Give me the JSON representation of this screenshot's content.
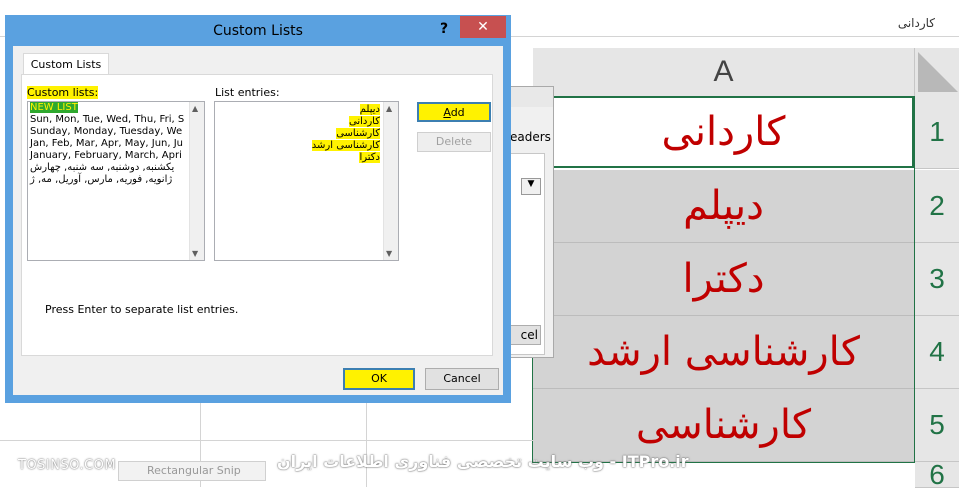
{
  "excel": {
    "formula_text": "کاردانی",
    "column_header": "A",
    "cells": [
      "کاردانی",
      "دیپلم",
      "دکترا",
      "کارشناسی ارشد",
      "کارشناسی"
    ],
    "row_numbers": [
      "1",
      "2",
      "3",
      "4",
      "5",
      "6"
    ]
  },
  "behind_dialog": {
    "partial_text": "eaders",
    "cancel_partial": "cel"
  },
  "dialog": {
    "title": "Custom Lists",
    "help": "?",
    "close": "✕",
    "tab": "Custom Lists",
    "custom_lists_label": "Custom lists:",
    "list_entries_label": "List entries:",
    "custom_lists": [
      "NEW LIST",
      "Sun, Mon, Tue, Wed, Thu, Fri, S",
      "Sunday, Monday, Tuesday, We",
      "Jan, Feb, Mar, Apr, May, Jun, Ju",
      "January, February, March, Apri",
      "یکشنبه, دوشنبه, سه شنبه, چهارش",
      "ژانویه, فوریه, مارس, آوریل, مه, ژ"
    ],
    "list_entries": [
      "دیپلم",
      "کاردانی",
      "کارشناسی",
      "کارشناسی ارشد",
      "دکترا"
    ],
    "add_label_accel": "A",
    "add_label_rest": "dd",
    "delete_label": "Delete",
    "hint": "Press Enter to separate list entries.",
    "ok_label": "OK",
    "cancel_label": "Cancel"
  },
  "watermark": {
    "left": "TOSINSO.COM",
    "snip": "Rectangular Snip",
    "right": "وب سایت تخصصی فناوری اطلاعات ایران - ITPro.ir"
  },
  "colors": {
    "accent_green": "#217346",
    "cell_text": "#c00000",
    "highlight": "#fff200",
    "dialog_frame": "#5aa1e0",
    "close_red": "#c75050"
  }
}
